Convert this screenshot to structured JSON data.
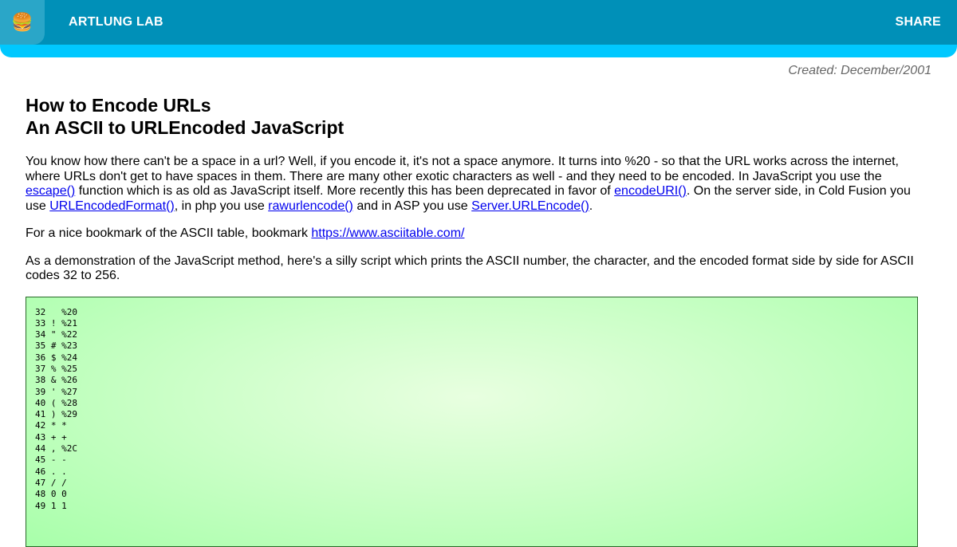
{
  "header": {
    "home_icon": "🍔",
    "brand": "ARTLUNG LAB",
    "share": "SHARE"
  },
  "created": "Created: December/2001",
  "title_line1": "How to Encode URLs",
  "title_line2": "An ASCII to URLEncoded JavaScript",
  "intro": {
    "t1": "You know how there can't be a space in a url? Well, if you encode it, it's not a space anymore. It turns into %20 - so that the URL works across the internet, where URLs don't get to have spaces in them. There are many other exotic characters as well - and they need to be encoded. In JavaScript you use the ",
    "link_escape": "escape()",
    "t2": " function which is as old as JavaScript itself. More recently this has been deprecated in favor of ",
    "link_encodeuri": "encodeURI()",
    "t3": ". On the server side, in Cold Fusion you use ",
    "link_urlencodedformat": "URLEncodedFormat()",
    "t4": ", in php you use ",
    "link_rawurlencode": "rawurlencode()",
    "t5": " and in ASP you use ",
    "link_server_urlencode": "Server.URLEncode()",
    "t6": "."
  },
  "bookmark": {
    "text": "For a nice bookmark of the ASCII table, bookmark ",
    "link": "https://www.asciitable.com/"
  },
  "demo_text": "As a demonstration of the JavaScript method, here's a silly script which prints the ASCII number, the character, and the encoded format side by side for ASCII codes 32 to 256.",
  "ascii_rows": [
    "32   %20",
    "33 ! %21",
    "34 \" %22",
    "35 # %23",
    "36 $ %24",
    "37 % %25",
    "38 & %26",
    "39 ' %27",
    "40 ( %28",
    "41 ) %29",
    "42 * *",
    "43 + +",
    "44 , %2C",
    "45 - -",
    "46 . .",
    "47 / /",
    "48 0 0",
    "49 1 1"
  ]
}
